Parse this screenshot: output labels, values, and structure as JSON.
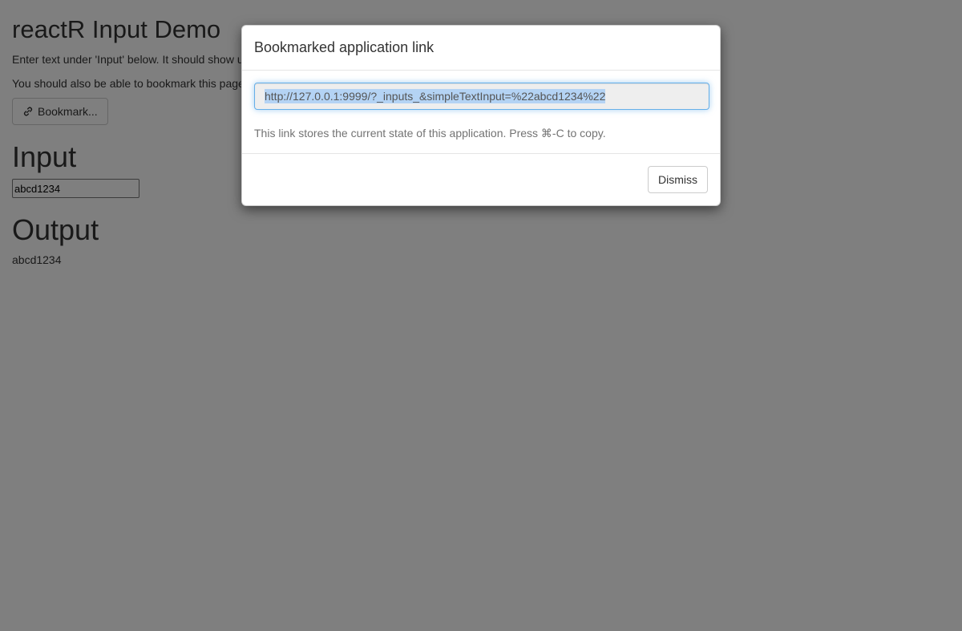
{
  "app": {
    "title": "reactR Input Demo",
    "instructions": "Enter text under 'Input' below. It should show up under 'Output'.",
    "bookmark_note": "You should also be able to bookmark this page.",
    "bookmark_button_label": "Bookmark..."
  },
  "input_section": {
    "heading": "Input",
    "value": "abcd1234"
  },
  "output_section": {
    "heading": "Output",
    "value": "abcd1234"
  },
  "modal": {
    "title": "Bookmarked application link",
    "url": "http://127.0.0.1:9999/?_inputs_&simpleTextInput=%22abcd1234%22",
    "help_text": "This link stores the current state of this application. Press ⌘-C to copy.",
    "dismiss_label": "Dismiss"
  },
  "icons": {
    "bookmark_button_icon": "link-icon"
  }
}
